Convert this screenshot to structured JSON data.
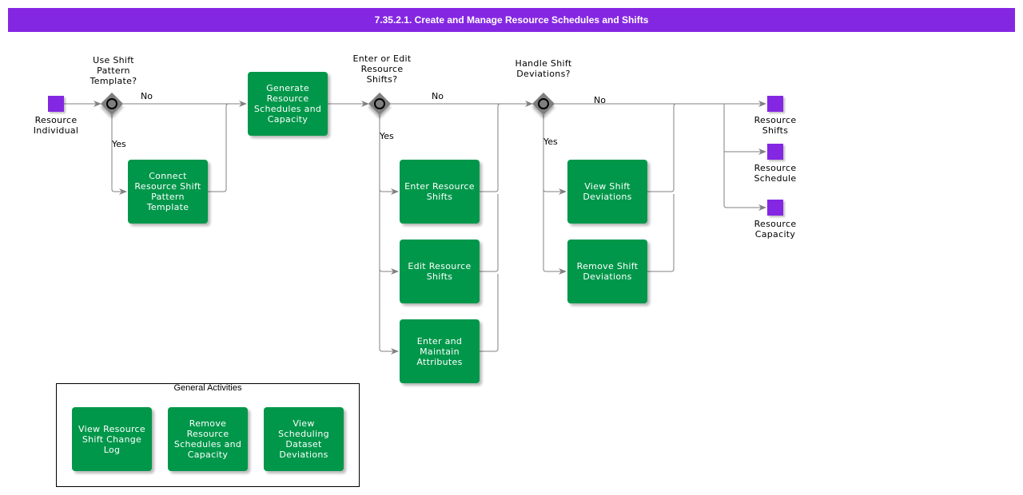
{
  "header": {
    "title": "7.35.2.1. Create and Manage Resource Schedules and Shifts"
  },
  "colors": {
    "title_bar": "#8427e2",
    "task": "#00974a",
    "data_object": "#8427e2",
    "gateway": "#7f7f7f",
    "connector": "#808080"
  },
  "inputs": [
    {
      "label": "Resource\nIndividual"
    }
  ],
  "gateways": [
    {
      "label": "Use Shift\nPattern\nTemplate?",
      "no": "No",
      "yes": "Yes"
    },
    {
      "label": "Enter or Edit\nResource\nShifts?",
      "no": "No",
      "yes": "Yes"
    },
    {
      "label": "Handle Shift\nDeviations?",
      "no": "No",
      "yes": "Yes"
    }
  ],
  "tasks": {
    "connect_template": "Connect\nResource Shift\nPattern\nTemplate",
    "generate": "Generate\nResource\nSchedules and\nCapacity",
    "enter_shifts": "Enter Resource\nShifts",
    "edit_shifts": "Edit Resource\nShifts",
    "maintain_attributes": "Enter and\nMaintain\nAttributes",
    "view_deviations": "View Shift\nDeviations",
    "remove_deviations": "Remove Shift\nDeviations"
  },
  "outputs": [
    {
      "label": "Resource\nShifts"
    },
    {
      "label": "Resource\nSchedule"
    },
    {
      "label": "Resource\nCapacity"
    }
  ],
  "general_activities": {
    "title": "General Activities",
    "items": [
      "View Resource\nShift Change\nLog",
      "Remove\nResource\nSchedules and\nCapacity",
      "View Scheduling\nDataset\nDeviations"
    ]
  }
}
